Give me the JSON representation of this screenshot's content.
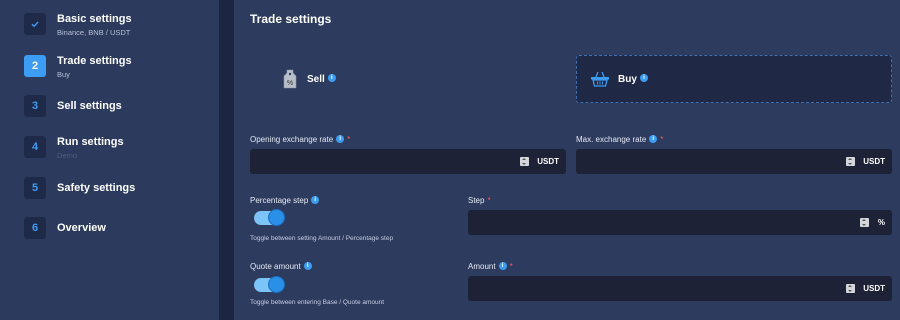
{
  "sidebar": {
    "steps": [
      {
        "num": "",
        "title": "Basic settings",
        "sub": "Binance, BNB / USDT"
      },
      {
        "num": "2",
        "title": "Trade settings",
        "sub": "Buy"
      },
      {
        "num": "3",
        "title": "Sell settings",
        "sub": ""
      },
      {
        "num": "4",
        "title": "Run settings",
        "sub": "Demo"
      },
      {
        "num": "5",
        "title": "Safety settings",
        "sub": ""
      },
      {
        "num": "6",
        "title": "Overview",
        "sub": ""
      }
    ]
  },
  "main": {
    "title": "Trade settings",
    "sell": {
      "label": "Sell",
      "icon": "percent-tag-icon"
    },
    "buy": {
      "label": "Buy",
      "icon": "basket-icon",
      "selected": true
    },
    "info_glyph": "i",
    "required_mark": "*",
    "opening_rate": {
      "label": "Opening exchange rate",
      "value": "",
      "unit": "USDT"
    },
    "max_rate": {
      "label": "Max. exchange rate",
      "value": "",
      "unit": "USDT"
    },
    "percentage_step": {
      "label": "Percentage step",
      "hint": "Toggle between setting Amount / Percentage step",
      "on": true
    },
    "step": {
      "label": "Step",
      "value": "",
      "unit": "%"
    },
    "quote_amount": {
      "label": "Quote amount",
      "hint": "Toggle between entering Base / Quote amount",
      "on": true
    },
    "amount": {
      "label": "Amount",
      "value": "",
      "unit": "USDT"
    }
  },
  "colors": {
    "accent": "#3d9df5",
    "required": "#ff5a5a",
    "sidebar_bg": "#2b3a5d",
    "input_bg": "#1d2237"
  }
}
